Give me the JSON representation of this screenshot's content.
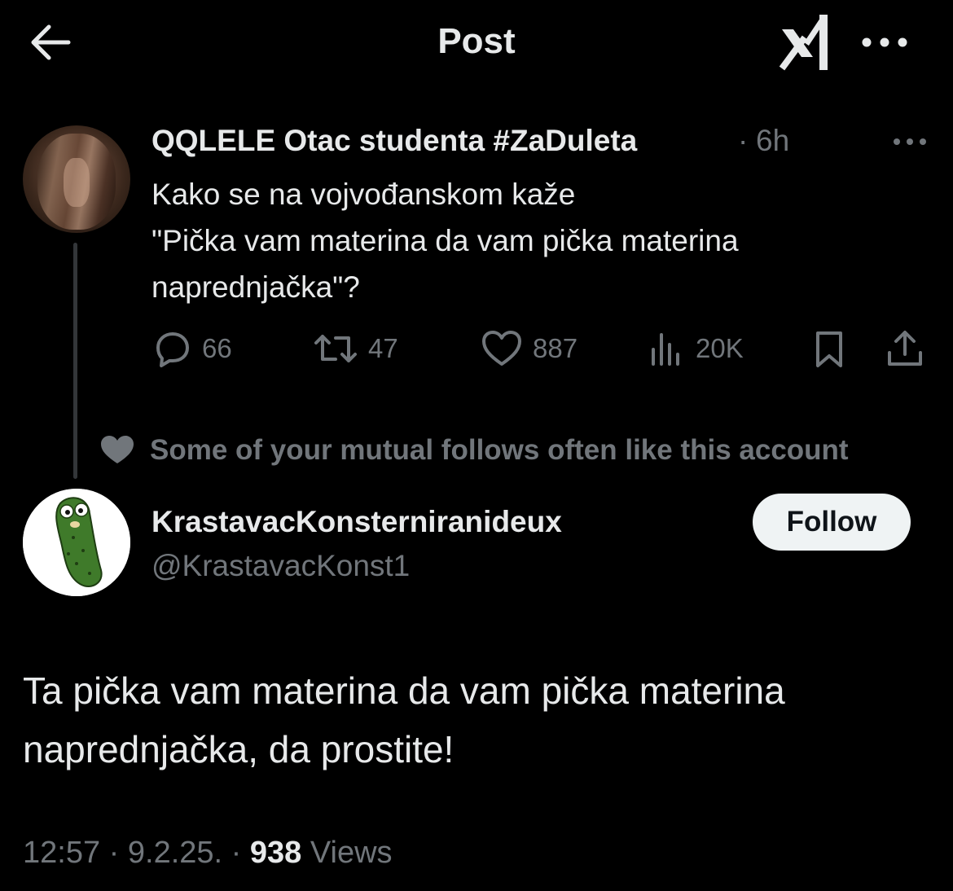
{
  "header": {
    "title": "Post",
    "back_icon": "arrow-left-icon",
    "grok_icon": "grok-icon",
    "more_icon": "more-horizontal-icon"
  },
  "parent_tweet": {
    "author_name": "QQLELE Otac studenta #ZaDuleta",
    "separator": "·",
    "time": "6h",
    "text": "Kako se na vojvođanskom kaže\n\"Pička vam materina da vam pička materina\nnaprednjačka\"?",
    "actions": {
      "replies": "66",
      "reposts": "47",
      "likes": "887",
      "views": "20K"
    }
  },
  "social_context": {
    "text": "Some of your mutual follows often like this account",
    "icon": "heart-filled-icon"
  },
  "reply": {
    "author_name": "KrastavacKonsterniranideux",
    "handle": "@KrastavacKonst1",
    "follow_label": "Follow",
    "text": "Ta pička vam materina da vam pička materina\nnaprednjačka, da prostite!",
    "meta": {
      "time": "12:57",
      "date": "9.2.25.",
      "views_count": "938",
      "views_label": "Views"
    }
  },
  "colors": {
    "background": "#000000",
    "primary_text": "#e7e9ea",
    "secondary_text": "#71767b",
    "follow_bg": "#eff3f4",
    "thread_line": "#333639"
  }
}
